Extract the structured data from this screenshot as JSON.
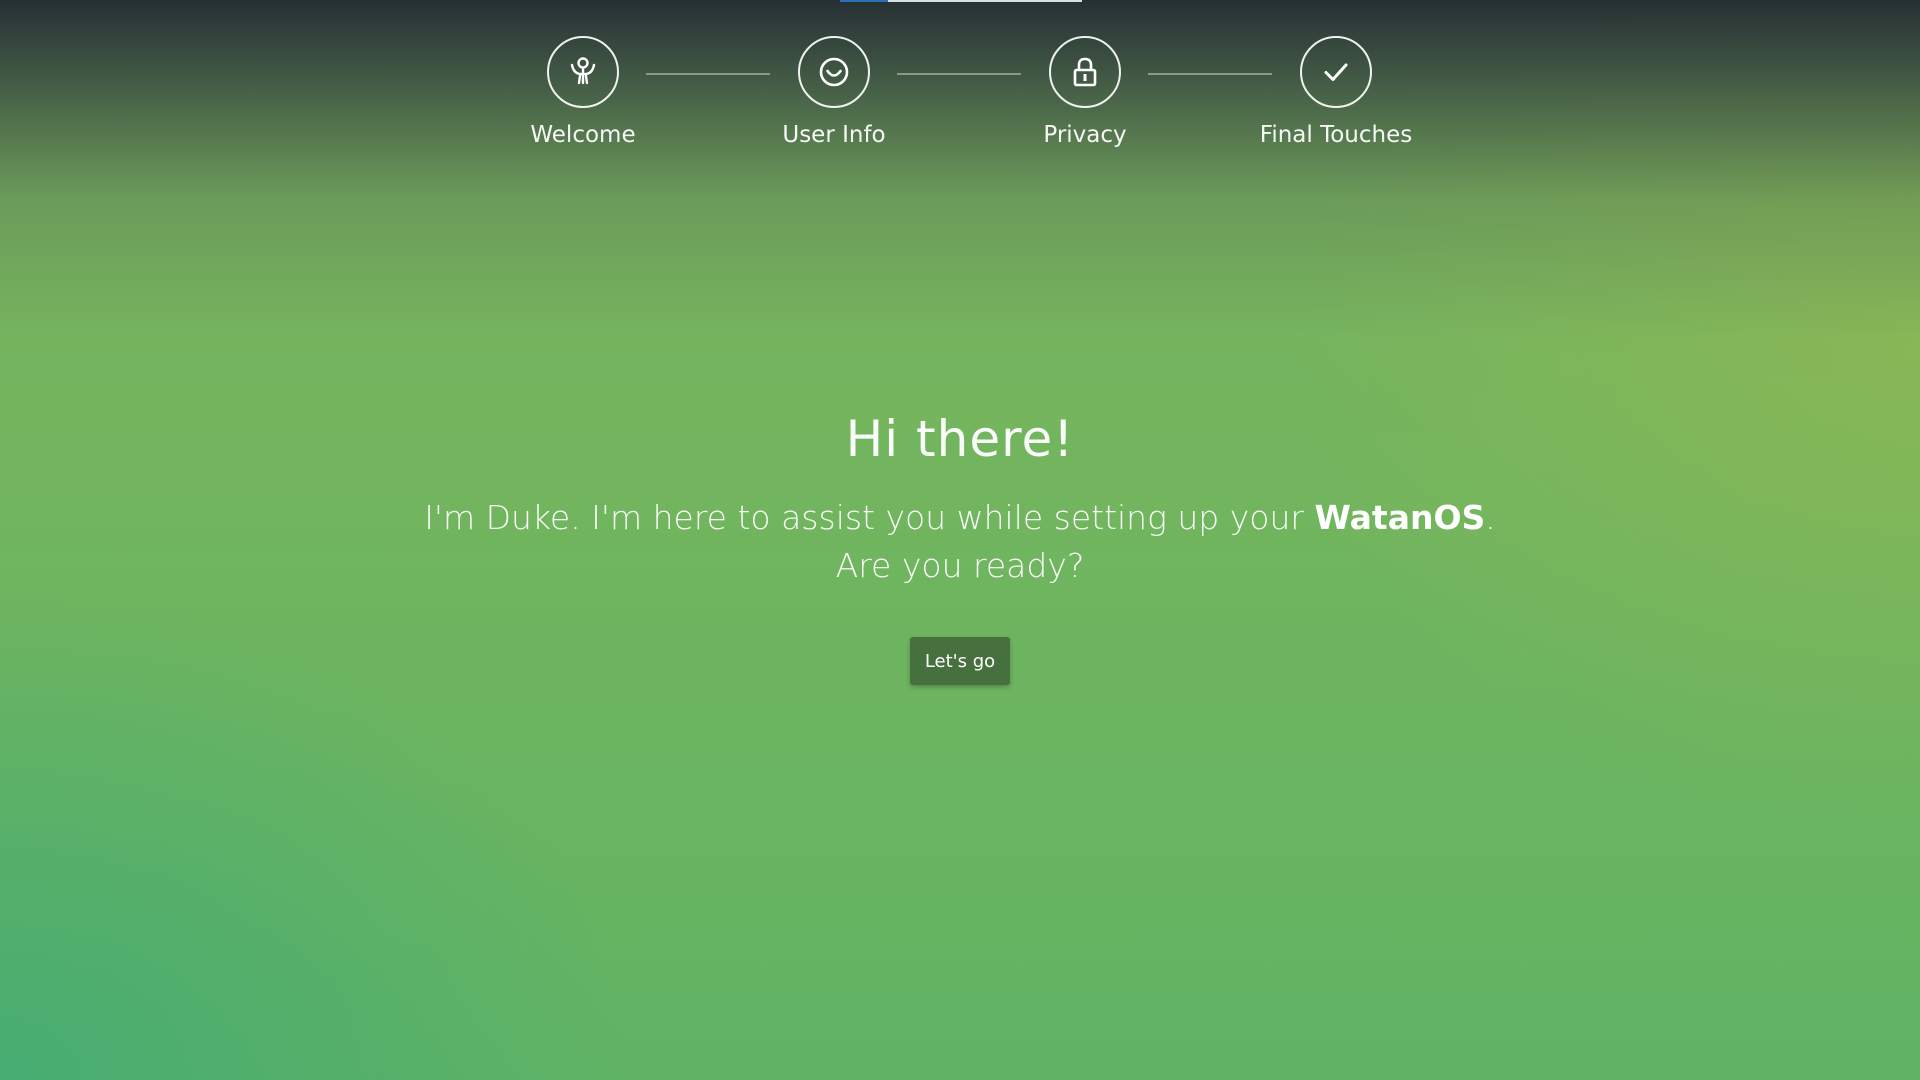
{
  "steps": [
    {
      "label": "Welcome",
      "icon": "welcome-person-icon"
    },
    {
      "label": "User Info",
      "icon": "smiley-icon"
    },
    {
      "label": "Privacy",
      "icon": "lock-icon"
    },
    {
      "label": "Final Touches",
      "icon": "checkmark-icon"
    }
  ],
  "hero": {
    "title": "Hi there!",
    "intro_before": "I'm Duke. I'm here to assist you while setting up your ",
    "brand": "WatanOS",
    "intro_after": ".",
    "question": "Are you ready?"
  },
  "actions": {
    "start_label": "Let's go"
  },
  "colors": {
    "button_bg": "#47703f",
    "indicator_active": "#2a6fb4"
  }
}
